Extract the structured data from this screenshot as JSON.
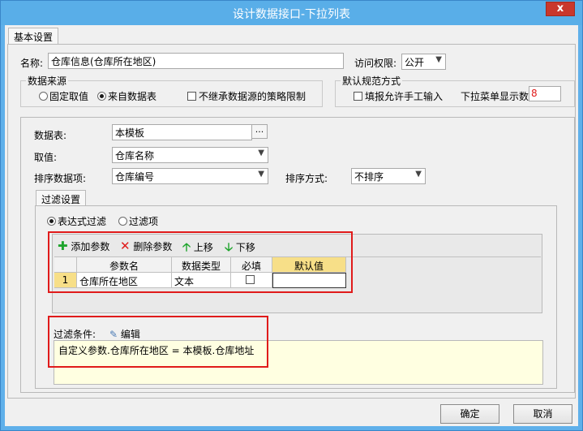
{
  "window": {
    "title": "设计数据接口-下拉列表",
    "close_glyph": "x"
  },
  "tabs": {
    "basic": "基本设置",
    "filter": "过滤设置"
  },
  "name_field": {
    "label": "名称:",
    "value": "仓库信息(仓库所在地区)"
  },
  "access": {
    "label": "访问权限:",
    "value": "公开"
  },
  "data_source": {
    "title": "数据来源",
    "fixed": "固定取值",
    "from_table": "来自数据表",
    "selected": "来自数据表",
    "no_inherit": "不继承数据源的策略限制"
  },
  "default_spec": {
    "title": "默认规范方式",
    "allow_manual": "填报允许手工输入",
    "dropdown_count_label": "下拉菜单显示数",
    "dropdown_count_value": "8"
  },
  "form": {
    "table_label": "数据表:",
    "table_value": "本模板",
    "browse_button": "...",
    "value_label": "取值:",
    "value_value": "仓库名称",
    "sort_item_label": "排序数据项:",
    "sort_item_value": "仓库编号",
    "sort_mode_label": "排序方式:",
    "sort_mode_value": "不排序"
  },
  "filter": {
    "expr_radio": "表达式过滤",
    "item_radio": "过滤项",
    "selected": "表达式过滤"
  },
  "params_toolbar": {
    "add": "添加参数",
    "delete": "删除参数",
    "up": "上移",
    "down": "下移"
  },
  "params_table": {
    "columns": [
      "参数名",
      "数据类型",
      "必填",
      "默认值"
    ],
    "rows": [
      {
        "index": "1",
        "name": "仓库所在地区",
        "type": "文本",
        "required": false,
        "default": ""
      }
    ]
  },
  "condition": {
    "label": "过滤条件:",
    "edit": "编辑",
    "expression": "自定义参数.仓库所在地区 = 本模板.仓库地址"
  },
  "footer": {
    "ok": "确定",
    "cancel": "取消"
  },
  "colors": {
    "accent": "#59aee8",
    "close": "#c9372c",
    "highlight": "#e01b1b",
    "expr_bg": "#ffffe1",
    "default_col": "#f7df88"
  }
}
